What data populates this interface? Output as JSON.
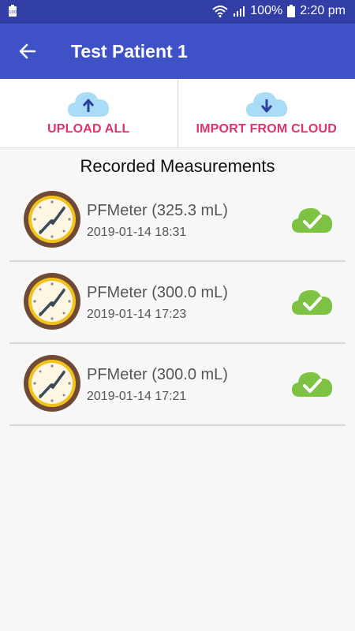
{
  "status_bar": {
    "battery_level": "100",
    "battery": "100%",
    "time": "2:20 pm",
    "icons": [
      "battery-icon",
      "wifi-icon",
      "signal-icon"
    ]
  },
  "app_bar": {
    "title": "Test Patient 1",
    "back_icon": "back-arrow-icon",
    "color": "#3f51c6",
    "status_color": "#303ea6"
  },
  "actions": {
    "upload_label": "UPLOAD ALL",
    "import_label": "IMPORT FROM CLOUD",
    "label_color": "#e0336b"
  },
  "section_title": "Recorded Measurements",
  "measurements": [
    {
      "name": "PFMeter (325.3 mL)",
      "timestamp": "2019-01-14 18:31",
      "synced": true
    },
    {
      "name": "PFMeter (300.0 mL)",
      "timestamp": "2019-01-14 17:23",
      "synced": true
    },
    {
      "name": "PFMeter (300.0 mL)",
      "timestamp": "2019-01-14 17:21",
      "synced": true
    }
  ]
}
